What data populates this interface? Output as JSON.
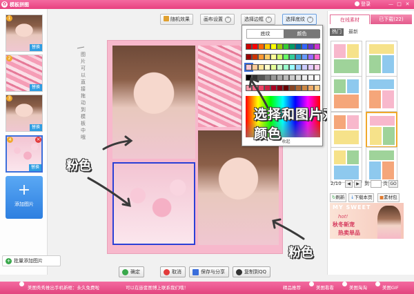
{
  "window": {
    "title": "模板拼图",
    "login": "登录",
    "controls": [
      "—",
      "□",
      "✕"
    ]
  },
  "left_panel": {
    "thumbs": [
      {
        "num": "1",
        "swap_label": "替换",
        "type": "face"
      },
      {
        "num": "2",
        "swap_label": "替换",
        "type": "notes"
      },
      {
        "num": "3",
        "swap_label": "替换",
        "type": "face"
      },
      {
        "num": "4",
        "swap_label": "替换",
        "type": "bows",
        "selected": true
      }
    ],
    "add_picture": "添加图片",
    "batch_add": "批量添加图片"
  },
  "toolbar": {
    "random": "随机效果",
    "layout_settings": "画布设置",
    "choose_border": "选择边框",
    "choose_texture": "选择底纹"
  },
  "color_picker": {
    "tab_texture": "底纹",
    "tab_color": "颜色",
    "collapse": "收起",
    "selected_color": "#f9c6d4",
    "swatches": [
      [
        "#cc0000",
        "#ff0000",
        "#ff6600",
        "#ffcc00",
        "#ffff00",
        "#99cc00",
        "#33cc33",
        "#009966",
        "#006699",
        "#3366ff",
        "#6633cc",
        "#cc33cc"
      ],
      [
        "#990000",
        "#cc3300",
        "#ff9933",
        "#ffcc66",
        "#ffff99",
        "#ccff66",
        "#66ff66",
        "#33cc99",
        "#3399cc",
        "#6699ff",
        "#9966ff",
        "#ff66cc"
      ],
      [
        "#f9c6d4",
        "#ffcc99",
        "#ffe699",
        "#ffffcc",
        "#e6ff99",
        "#ccffcc",
        "#99ffcc",
        "#99ffff",
        "#99ccff",
        "#ccccff",
        "#e6ccff",
        "#ffccee"
      ],
      [
        "#000000",
        "#333333",
        "#555555",
        "#777777",
        "#999999",
        "#aaaaaa",
        "#bbbbbb",
        "#cccccc",
        "#dddddd",
        "#eeeeee",
        "#f5f5f5",
        "#ffffff"
      ],
      [
        "#ff99aa",
        "#ff6688",
        "#ee4466",
        "#cc2244",
        "#aa0022",
        "#880011",
        "#660000",
        "#884422",
        "#aa6633",
        "#cc8844",
        "#eeaa66",
        "#ffcc88"
      ]
    ]
  },
  "annotations": {
    "vertical_tip": "图片可以直接拖动到模板中哦",
    "pink_left": "粉色",
    "pink_right": "粉色",
    "callout": "选择和图片对应的边框颜色"
  },
  "right_panel": {
    "tab_online": "在线素材",
    "tab_downloaded": "已下载(22)",
    "subtab_hot": "热门",
    "subtab_new": "最新",
    "page_current": "2/10",
    "page_to": "到",
    "page_unit": "页",
    "page_go": "GO",
    "refresh": "刷新",
    "download_page": "下载本页",
    "material_lib": "素材包",
    "ad_line1": "MY SWEET",
    "ad_line2": "hot!",
    "ad_line3": "秋冬新宠",
    "ad_line4": "热卖单品"
  },
  "actions": {
    "ok": "确定",
    "cancel": "取消",
    "save_share": "保存与分享",
    "copy_qq": "复制到QQ"
  },
  "statusbar": {
    "left1": "美图秀秀推出手机新框：永久免费啦",
    "left2": "可以在嵌套图博上联系我们哦！",
    "right1": "精品推荐",
    "right2": "美图看看",
    "right3": "美图淘淘",
    "right4": "美图GIF"
  }
}
